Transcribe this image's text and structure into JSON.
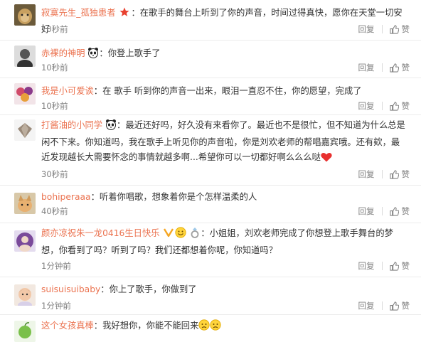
{
  "comments": [
    {
      "user": "寂寞先生_孤独患者",
      "sep": "：",
      "text": "在歌手的舞台上听到了你的声音，时间过得真快，愿你在天堂一切安好",
      "time": "10秒前",
      "reply": "回复",
      "like": "赞"
    },
    {
      "user": "赤裸的神明",
      "sep": "：",
      "text": "你登上歌手了",
      "time": "10秒前",
      "reply": "回复",
      "like": "赞"
    },
    {
      "user": "我是小可爱诶",
      "sep": "：",
      "text": "在 歌手 听到你的声音一出来，眼泪一直忍不住，你的愿望，完成了",
      "time": "10秒前",
      "reply": "回复",
      "like": "赞"
    },
    {
      "user": "打酱油的小同学",
      "sep": "：",
      "text": "最近还好吗，好久没有来看你了。最近也不是很忙，但不知道为什么总是闲不下来。你知道吗，我在歌手上听见你的声音啦，你是刘欢老师的帮唱嘉宾哦。还有欸，最近发现越长大需要怀念的事情就越多啊...希望你可以一切都好啊么么么哒",
      "time": "30秒前",
      "reply": "回复",
      "like": "赞"
    },
    {
      "user": "bohiperaaa",
      "sep": "：",
      "text": "听着你唱歌，想象着你是个怎样温柔的人",
      "time": "40秒前",
      "reply": "回复",
      "like": "赞"
    },
    {
      "user": "颜亦凉祝朱一龙0416生日快乐",
      "sep": "：",
      "text": "小姐姐，刘欢老师完成了你想登上歌手舞台的梦想，你看到了吗？听到了吗？我们还都想着你呢，你知道吗？",
      "time": "1分钟前",
      "reply": "回复",
      "like": "赞"
    },
    {
      "user": "suisuisuibaby",
      "sep": "：",
      "text": "你上了歌手，你做到了",
      "time": "1分钟前",
      "reply": "回复",
      "like": "赞"
    },
    {
      "user": "这个女孩真棒",
      "sep": "：",
      "text": "我好想你，你能不能回来",
      "time": "",
      "reply": "",
      "like": ""
    }
  ],
  "colors": {
    "username": "#eb7350",
    "text": "#333333",
    "meta": "#808080"
  },
  "icons": [
    "star-badge-icon",
    "panda-emoji-icon",
    "heart-emoji-icon",
    "v-badge-icon",
    "smile-emoji-icon",
    "ring-icon",
    "sad-emoji-icon",
    "thumbs-up-icon"
  ]
}
